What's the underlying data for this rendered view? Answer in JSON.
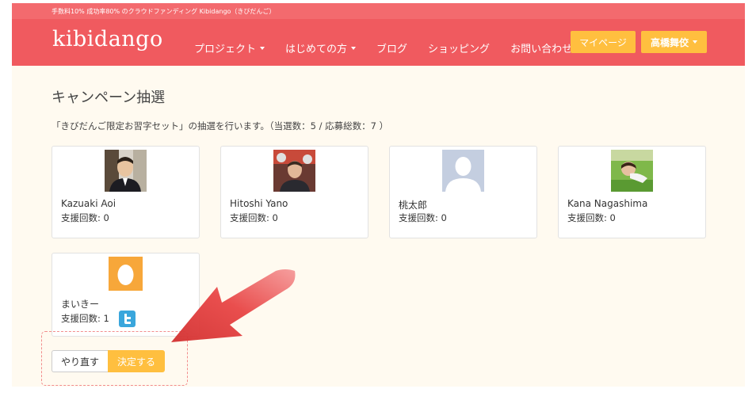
{
  "header": {
    "tagline": "手数料10% 成功率80% のクラウドファンディング Kibidango（きびだんご）",
    "logo": "kibidango",
    "nav": [
      {
        "label": "プロジェクト",
        "dropdown": true
      },
      {
        "label": "はじめての方",
        "dropdown": true
      },
      {
        "label": "ブログ",
        "dropdown": false
      },
      {
        "label": "ショッピング",
        "dropdown": false
      },
      {
        "label": "お問い合わせ",
        "dropdown": false
      }
    ],
    "mypage_label": "マイページ",
    "user_label": "高橋舞佼"
  },
  "main": {
    "title": "キャンペーン抽選",
    "description": "「きびだんご限定お習字セット」の抽選を行います。（当選数：5 / 応募総数：7 ）",
    "count_prefix": "支援回数: ",
    "winners": [
      {
        "name": "Kazuaki Aoi",
        "count": "0",
        "avatar": "photo-man-suit",
        "twitter": false
      },
      {
        "name": "Hitoshi Yano",
        "count": "0",
        "avatar": "photo-man-red",
        "twitter": false
      },
      {
        "name": "桃太郎",
        "count": "0",
        "avatar": "default-silhouette",
        "twitter": false
      },
      {
        "name": "Kana Nagashima",
        "count": "0",
        "avatar": "photo-woman-grass",
        "twitter": false
      },
      {
        "name": "まいきー",
        "count": "1",
        "avatar": "egg",
        "twitter": true
      }
    ],
    "redo_label": "やり直す",
    "decide_label": "決定する"
  },
  "colors": {
    "header": "#f05a5f",
    "accent": "#ffbf3f",
    "page_bg": "#fffaf0",
    "annotation": "#e84545"
  }
}
